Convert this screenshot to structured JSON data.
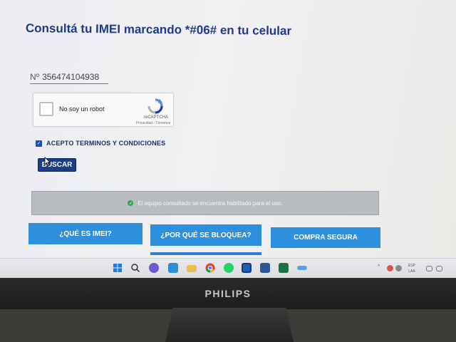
{
  "page": {
    "title": "Consultá tu IMEI marcando *#06# en tu celular"
  },
  "imei_field": {
    "prefix": "Nº",
    "value": "356474104938"
  },
  "recaptcha": {
    "label": "No soy un robot",
    "brand": "reCAPTCHA",
    "links": "Privacidad - Términos"
  },
  "terms": {
    "label": "ACEPTO TERMINOS Y CONDICIONES",
    "checked": true
  },
  "search_button": {
    "label": "BUSCAR"
  },
  "status": {
    "message": "El equipo consultado se encuentra habilitado para el uso.",
    "color": "#2fa84f"
  },
  "nav": {
    "buttons": [
      {
        "label": "¿QUÉ ES IMEI?"
      },
      {
        "label": "¿POR QUÉ SE BLOQUEA?"
      },
      {
        "label": "COMPRA SEGURA"
      }
    ],
    "accent": "#2e8fdc"
  },
  "taskbar": {
    "icons": [
      "windows-start-icon",
      "search-icon",
      "chat-icon",
      "mail-icon",
      "folder-icon",
      "chrome-icon",
      "whatsapp-icon",
      "clock-app-icon",
      "word-icon",
      "excel-icon",
      "more-icon"
    ],
    "tray": {
      "language": "ESP",
      "layout": "LAA"
    }
  },
  "monitor": {
    "brand": "PHILIPS"
  }
}
